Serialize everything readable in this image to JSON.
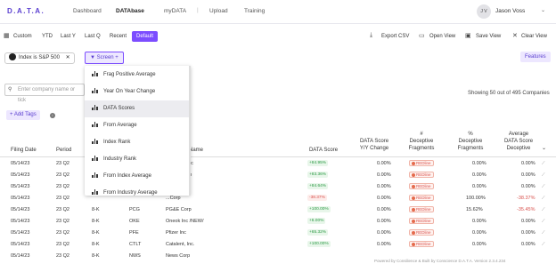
{
  "nav": {
    "logo": "D.A.T.A.",
    "links": [
      "Dashboard",
      "DATAbase",
      "myDATA",
      "Upload",
      "Training"
    ],
    "separator": "|",
    "user_initials": "J V",
    "user_name": "Jason Voss"
  },
  "toolbar": {
    "ranges": [
      "Custom",
      "YTD",
      "Last Y",
      "Last Q",
      "Recent",
      "Default"
    ],
    "actions": [
      "Export CSV",
      "Open View",
      "Save View",
      "Clear View"
    ]
  },
  "filter": {
    "chip_label": "Index is S&P 500",
    "screen_label": "Screen +",
    "features_label": "Features"
  },
  "search": {
    "placeholder": "Enter company name or tick"
  },
  "showing": "Showing 50 out of 495 Companies",
  "add_tags": "+ Add Tags",
  "dropdown": {
    "items": [
      "Frag Positive Average",
      "Year On Year Change",
      "DATA Scores",
      "From Average",
      "Index Rank",
      "Industry Rank",
      "From Index Average",
      "From Industry Average"
    ],
    "highlighted": "DATA Scores"
  },
  "table": {
    "headers": {
      "filing_date": "Filing Date",
      "period": "Period",
      "name": "Name",
      "data_score": "DATA Score",
      "yy_change": [
        "DATA Score",
        "Y/Y Change"
      ],
      "deceptive_fragments": [
        "#",
        "Deceptive",
        "Fragments"
      ],
      "pct_deceptive": [
        "%",
        "Deceptive",
        "Fragments"
      ],
      "avg_score": [
        "Average",
        "DATA Score",
        "Deceptive"
      ]
    },
    "rows": [
      {
        "date": "05/14/23",
        "period": "23 Q2",
        "form": "",
        "ticker": "",
        "name": "...ologies Inc",
        "score": "+84.95%",
        "yy": "0.00%",
        "frag": "REDline",
        "pct": "0.00%",
        "avg": "0.00%"
      },
      {
        "date": "05/14/23",
        "period": "23 Q2",
        "form": "",
        "ticker": "",
        "name": "...xpress Co",
        "score": "+83.36%",
        "yy": "0.00%",
        "frag": "REDline",
        "pct": "0.00%",
        "avg": "0.00%"
      },
      {
        "date": "05/14/23",
        "period": "23 Q2",
        "form": "",
        "ticker": "",
        "name": "...Corp",
        "score": "+84.64%",
        "yy": "0.00%",
        "frag": "REDline",
        "pct": "0.00%",
        "avg": "0.00%"
      },
      {
        "date": "05/14/23",
        "period": "23 Q2",
        "form": "",
        "ticker": "",
        "name": "...Corp",
        "score": "-38.37%",
        "yy": "0.00%",
        "frag": "REDline",
        "pct": "100.00%",
        "avg": "-38.37%"
      },
      {
        "date": "05/14/23",
        "period": "23 Q2",
        "form": "8-K",
        "ticker": "PCG",
        "name": "PG&E Corp",
        "score": "+100.00%",
        "yy": "0.00%",
        "frag": "REDline",
        "pct": "15.62%",
        "avg": "-35.45%"
      },
      {
        "date": "05/14/23",
        "period": "23 Q2",
        "form": "8-K",
        "ticker": "OKE",
        "name": "Oneok Inc /NEW/",
        "score": "+6.00%",
        "yy": "0.00%",
        "frag": "REDline",
        "pct": "0.00%",
        "avg": "0.00%"
      },
      {
        "date": "05/14/23",
        "period": "23 Q2",
        "form": "8-K",
        "ticker": "PFE",
        "name": "Pfizer Inc",
        "score": "+65.32%",
        "yy": "0.00%",
        "frag": "REDline",
        "pct": "0.00%",
        "avg": "0.00%"
      },
      {
        "date": "05/14/23",
        "period": "23 Q2",
        "form": "8-K",
        "ticker": "CTLT",
        "name": "Catalent, Inc.",
        "score": "+100.00%",
        "yy": "0.00%",
        "frag": "REDline",
        "pct": "0.00%",
        "avg": "0.00%"
      },
      {
        "date": "05/14/23",
        "period": "23 Q2",
        "form": "8-K",
        "ticker": "NWS",
        "name": "News Corp",
        "score": "",
        "yy": "",
        "frag": "",
        "pct": "",
        "avg": ""
      }
    ]
  },
  "footer": "Powered by Consilience & Built by Conscience D.A.T.A. Version 2.3.4.234"
}
